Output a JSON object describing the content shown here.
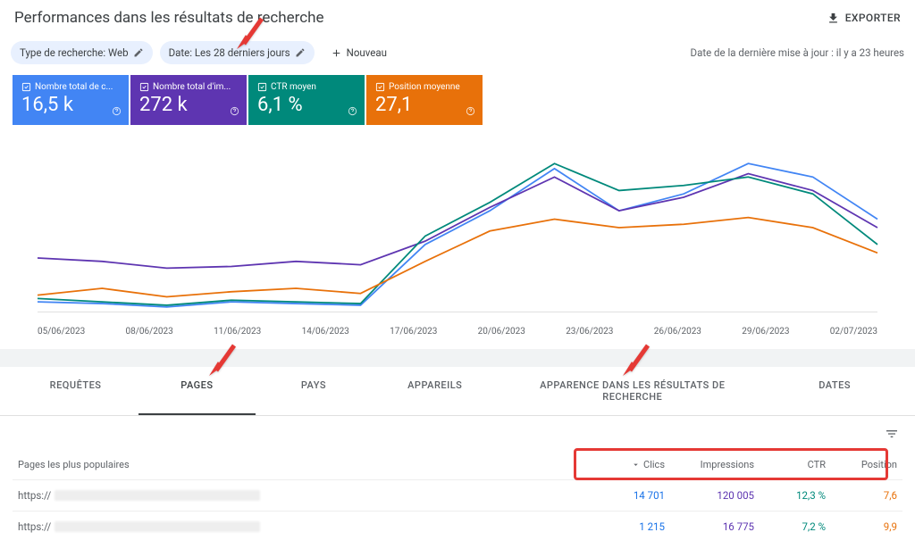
{
  "header": {
    "page_title": "Performances dans les résultats de recherche",
    "export_label": "EXPORTER"
  },
  "filters": {
    "search_type_label": "Type de recherche: Web",
    "date_label": "Date: Les 28 derniers jours",
    "new_label": "Nouveau",
    "last_update": "Date de la dernière mise à jour : il y a 23 heures"
  },
  "tiles": {
    "clicks": {
      "label": "Nombre total de c...",
      "value": "16,5 k"
    },
    "impressions": {
      "label": "Nombre total d'im...",
      "value": "272 k"
    },
    "ctr": {
      "label": "CTR moyen",
      "value": "6,1 %"
    },
    "position": {
      "label": "Position moyenne",
      "value": "27,1"
    }
  },
  "tabs": {
    "requetes": "REQUÊTES",
    "pages": "PAGES",
    "pays": "PAYS",
    "appareils": "APPAREILS",
    "apparence": "APPARENCE DANS LES RÉSULTATS DE RECHERCHE",
    "dates": "DATES"
  },
  "table": {
    "caption": "Pages les plus populaires",
    "headers": {
      "clicks": "Clics",
      "impressions": "Impressions",
      "ctr": "CTR",
      "position": "Position"
    },
    "rows": [
      {
        "url_prefix": "https://",
        "clicks": "14 701",
        "impressions": "120 005",
        "ctr": "12,3 %",
        "position": "7,6"
      },
      {
        "url_prefix": "https://",
        "clicks": "1 215",
        "impressions": "16 775",
        "ctr": "7,2 %",
        "position": "9,9"
      }
    ]
  },
  "chart_data": {
    "type": "line",
    "x": [
      "05/06/2023",
      "08/06/2023",
      "11/06/2023",
      "14/06/2023",
      "17/06/2023",
      "20/06/2023",
      "23/06/2023",
      "26/06/2023",
      "29/06/2023",
      "02/07/2023"
    ],
    "series": [
      {
        "name": "Clics",
        "color": "#4285f4",
        "values_norm": [
          0.06,
          0.05,
          0.03,
          0.06,
          0.05,
          0.04,
          0.4,
          0.6,
          0.85,
          0.6,
          0.7,
          0.88,
          0.8,
          0.55
        ]
      },
      {
        "name": "Impressions",
        "color": "#5e35b1",
        "values_norm": [
          0.32,
          0.3,
          0.26,
          0.27,
          0.3,
          0.28,
          0.42,
          0.62,
          0.8,
          0.6,
          0.68,
          0.82,
          0.72,
          0.5
        ]
      },
      {
        "name": "CTR",
        "color": "#00897b",
        "values_norm": [
          0.08,
          0.06,
          0.04,
          0.07,
          0.06,
          0.05,
          0.45,
          0.65,
          0.88,
          0.72,
          0.75,
          0.8,
          0.7,
          0.4
        ]
      },
      {
        "name": "Position",
        "color": "#e8710a",
        "values_norm": [
          0.1,
          0.14,
          0.09,
          0.12,
          0.14,
          0.11,
          0.3,
          0.48,
          0.55,
          0.5,
          0.52,
          0.56,
          0.5,
          0.35
        ]
      }
    ],
    "xlabel": "",
    "ylabel": ""
  }
}
